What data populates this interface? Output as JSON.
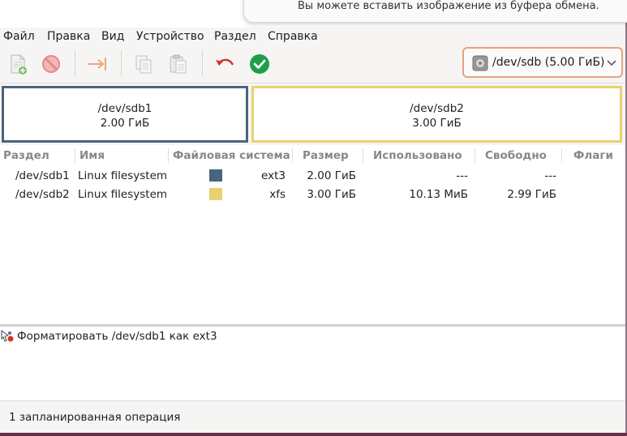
{
  "notification": {
    "text": "Вы можете вставить изображение из буфера обмена."
  },
  "menu": [
    "Файл",
    "Правка",
    "Вид",
    "Устройство",
    "Раздел",
    "Справка"
  ],
  "device": {
    "label": "/dev/sdb (5.00 ГиБ)",
    "icon": "disk-icon"
  },
  "partition_map": [
    {
      "name": "/dev/sdb1",
      "size": "2.00 ГиБ",
      "color": "#4a6480"
    },
    {
      "name": "/dev/sdb2",
      "size": "3.00 ГиБ",
      "color": "#e8d16f"
    }
  ],
  "columns": {
    "partition": "Раздел",
    "name": "Имя",
    "fs": "Файловая система",
    "size": "Размер",
    "used": "Использовано",
    "free": "Свободно",
    "flags": "Флаги"
  },
  "rows": [
    {
      "partition": "/dev/sdb1",
      "name": "Linux filesystem",
      "color": "#4a6480",
      "fs": "ext3",
      "size": "2.00 ГиБ",
      "used": "---",
      "free": "---",
      "flags": ""
    },
    {
      "partition": "/dev/sdb2",
      "name": "Linux filesystem",
      "color": "#e8d16f",
      "fs": "xfs",
      "size": "3.00 ГиБ",
      "used": "10.13 МиБ",
      "free": "2.99 ГиБ",
      "flags": ""
    }
  ],
  "operations": [
    "Форматировать /dev/sdb1 как ext3"
  ],
  "status": "1 запланированная операция"
}
